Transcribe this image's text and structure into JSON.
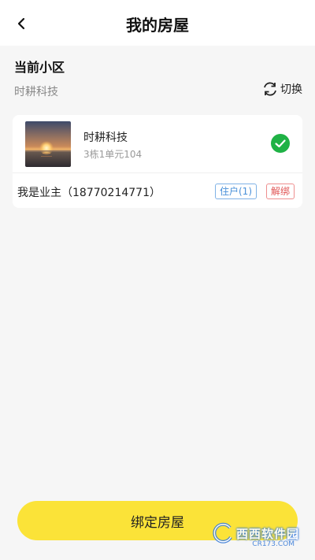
{
  "header": {
    "title": "我的房屋",
    "back_icon": "back-arrow-icon"
  },
  "current": {
    "section_title": "当前小区",
    "community_name": "时耕科技",
    "switch_label": "切换",
    "switch_icon": "refresh-icon"
  },
  "house": {
    "name": "时耕科技",
    "address": "3栋1单元104",
    "selected_icon": "check-circle-icon",
    "selected_color": "#1fb245",
    "owner_text": "我是业主（18770214771）",
    "resident_badge": "住户(1)",
    "unbind_badge": "解绑"
  },
  "footer": {
    "bind_button": "绑定房屋",
    "accent_color": "#fbe338"
  },
  "watermark": {
    "text": "西西软件园",
    "sub": "CR173.COM"
  }
}
